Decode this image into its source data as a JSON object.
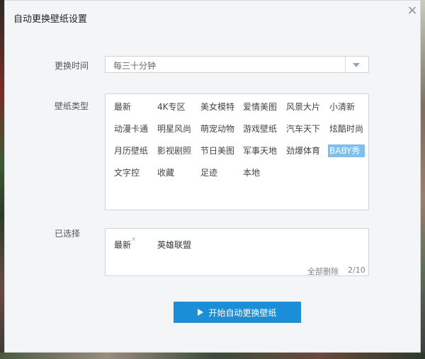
{
  "dialog": {
    "title": "自动更换壁纸设置",
    "close_icon": "close-icon"
  },
  "change_time": {
    "label": "更换时间",
    "value": "每三十分钟",
    "icon": "dropdown-arrow-icon"
  },
  "wallpaper_types": {
    "label": "壁纸类型",
    "items": [
      "最新",
      "4K专区",
      "美女模特",
      "爱情美图",
      "风景大片",
      "小清新",
      "动漫卡通",
      "明星风尚",
      "萌宠动物",
      "游戏壁纸",
      "汽车天下",
      "炫酷时尚",
      "月历壁纸",
      "影视剧照",
      "节日美图",
      "军事天地",
      "劲爆体育",
      "BABY秀",
      "文字控",
      "收藏",
      "足迹",
      "本地"
    ],
    "highlighted": "BABY秀"
  },
  "selected": {
    "label": "已选择",
    "items": [
      "最新",
      "英雄联盟"
    ],
    "remove_mark": "×",
    "clear_all": "全部删除",
    "count": "2/10"
  },
  "start_button": {
    "label": "开始自动更换壁纸",
    "icon": "play-icon"
  },
  "colors": {
    "accent": "#1a8fd8",
    "highlight": "#7bc0f0"
  }
}
